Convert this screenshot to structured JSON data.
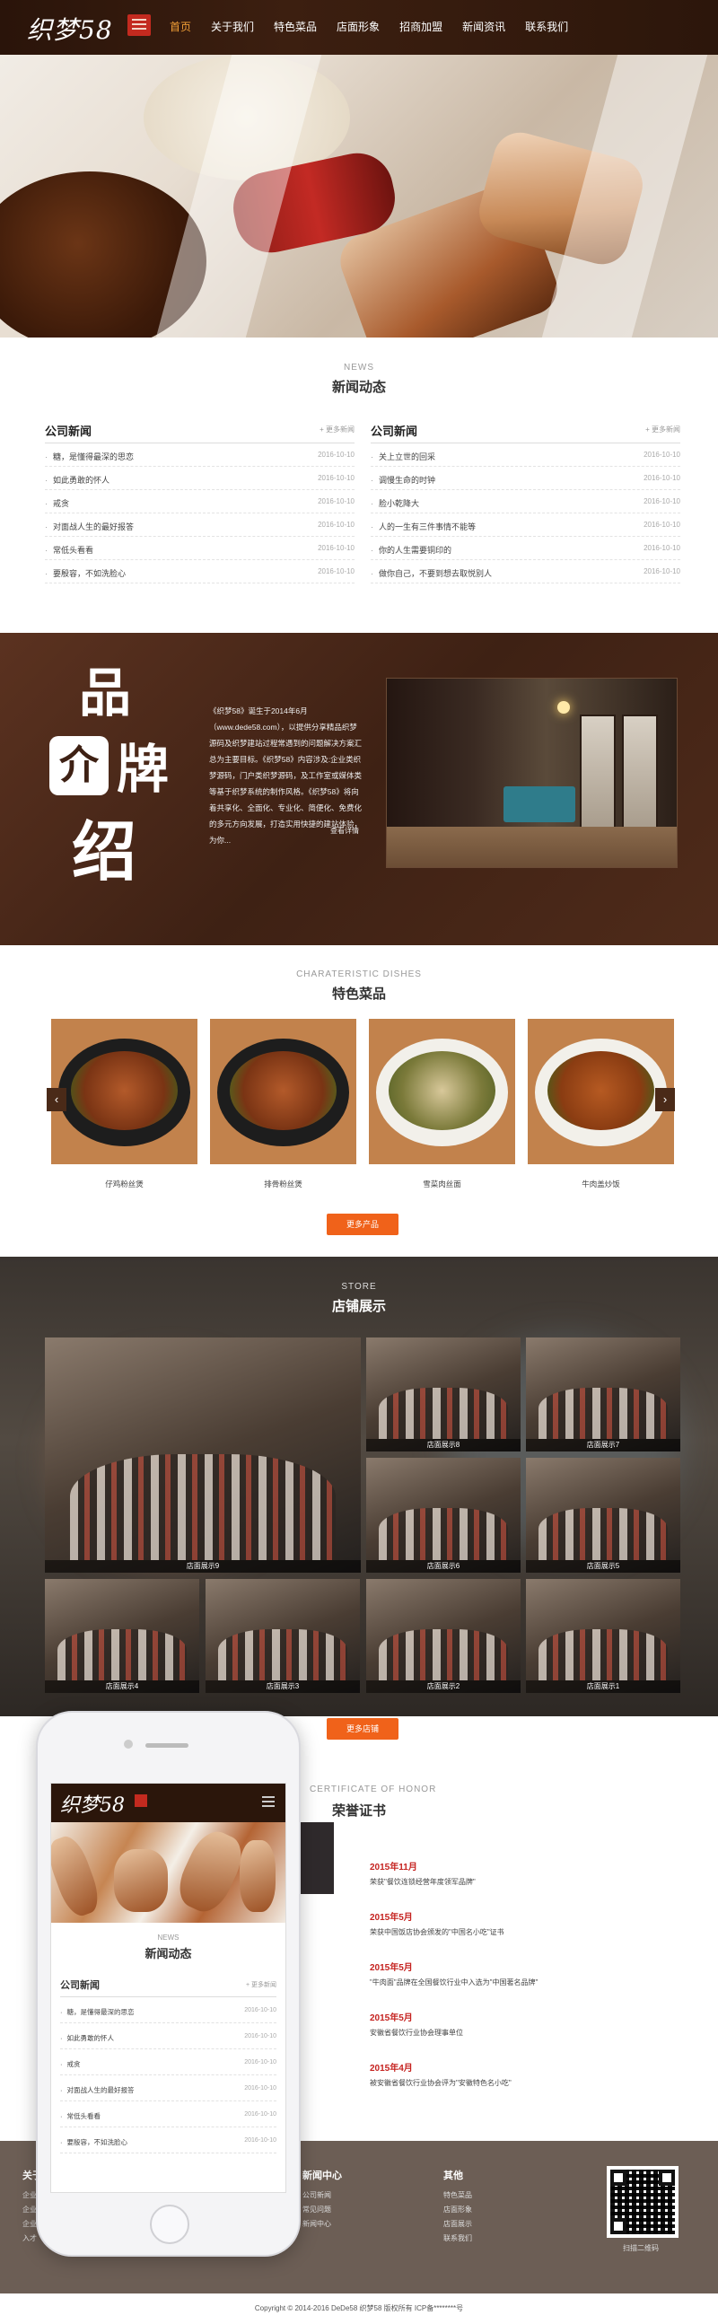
{
  "nav": {
    "logo_text": "织梦58",
    "items": [
      {
        "label": "首页",
        "active": true
      },
      {
        "label": "关于我们"
      },
      {
        "label": "特色菜品"
      },
      {
        "label": "店面形象"
      },
      {
        "label": "招商加盟"
      },
      {
        "label": "新闻资讯"
      },
      {
        "label": "联系我们"
      }
    ]
  },
  "news": {
    "en": "NEWS",
    "cn": "新闻动态",
    "columns": [
      {
        "title": "公司新闻",
        "more": "+ 更多新闻",
        "items": [
          {
            "t": "糖，是懂得最深的思恋",
            "d": "2016-10-10"
          },
          {
            "t": "如此勇敢的怀人",
            "d": "2016-10-10"
          },
          {
            "t": "戒贪",
            "d": "2016-10-10"
          },
          {
            "t": "对面战人生的最好报答",
            "d": "2016-10-10"
          },
          {
            "t": "常低头看看",
            "d": "2016-10-10"
          },
          {
            "t": "要殷容，不如洗脸心",
            "d": "2016-10-10"
          }
        ]
      },
      {
        "title": "公司新闻",
        "more": "+ 更多新闻",
        "items": [
          {
            "t": "关上立世的回采",
            "d": "2016-10-10"
          },
          {
            "t": "调慢生命的时钟",
            "d": "2016-10-10"
          },
          {
            "t": "脸小乾降大",
            "d": "2016-10-10"
          },
          {
            "t": "人的一生有三件事情不能等",
            "d": "2016-10-10"
          },
          {
            "t": "你的人生需要铜印的",
            "d": "2016-10-10"
          },
          {
            "t": "做你自己，不要到想去取悦别人",
            "d": "2016-10-10"
          }
        ]
      }
    ]
  },
  "brand": {
    "c1": "品",
    "c2": "介",
    "c3": "牌",
    "c4": "绍",
    "text": "《织梦58》诞生于2014年6月（www.dede58.com），以提供分享精品织梦源码及织梦建站过程常遇到的问题解决方案汇总为主要目标。《织梦58》内容涉及:企业类织梦源码，门户类织梦源码，及工作室或媒体类等基于织梦系统的制作风格。《织梦58》将向着共享化、全面化、专业化、简便化、免费化的多元方向发展，打造实用快捷的建站体验，为你...",
    "more": "查看详情"
  },
  "dishes": {
    "en": "CHARATERISTIC DISHES",
    "cn": "特色菜品",
    "items": [
      "仔鸡粉丝煲",
      "排骨粉丝煲",
      "雪菜肉丝面",
      "牛肉盖炒饭"
    ],
    "button": "更多产品"
  },
  "store": {
    "en": "STORE",
    "cn": "店铺展示",
    "items": [
      "店面展示9",
      "店面展示8",
      "店面展示7",
      "店面展示6",
      "店面展示5",
      "店面展示4",
      "店面展示3",
      "店面展示2",
      "店面展示1"
    ],
    "button": "更多店铺"
  },
  "cert": {
    "en": "CERTIFICATE OF HONOR",
    "cn": "荣誉证书",
    "items": [
      {
        "y": "2015年11月",
        "d": "荣获\"餐饮连锁经营年度领军品牌\""
      },
      {
        "y": "2015年5月",
        "d": "荣获中国饭店协会颁发的\"中国名小吃\"证书"
      },
      {
        "y": "2015年5月",
        "d": "\"牛肉面\"品牌在全国餐饮行业中入选为\"中国著名品牌\""
      },
      {
        "y": "2015年5月",
        "d": "安徽省餐饮行业协会理事单位"
      },
      {
        "y": "2015年4月",
        "d": "被安徽省餐饮行业协会评为\"安徽特色名小吃\""
      }
    ]
  },
  "footer": {
    "col1": "关于",
    "col2": "新闻中心",
    "col2_links": [
      "公司新闻",
      "常见问题",
      "新闻中心"
    ],
    "col3": "其他",
    "col3_links": [
      "特色菜品",
      "店面形象",
      "店面展示",
      "联系我们"
    ],
    "col1_links": [
      "企业",
      "企业",
      "企业",
      "入才"
    ],
    "qr_label": "扫描二维码",
    "copyright": "Copyright © 2014-2016 DeDe58 织梦58 版权所有    ICP备********号"
  },
  "phone": {
    "logo_text": "织梦58",
    "news_en": "NEWS",
    "news_cn": "新闻动态",
    "col_title": "公司新闻",
    "more": "+ 更多新闻",
    "items": [
      {
        "t": "糖，是懂得最深的思恋",
        "d": "2016-10-10"
      },
      {
        "t": "如此勇敢的怀人",
        "d": "2016-10-10"
      },
      {
        "t": "戒贪",
        "d": "2016-10-10"
      },
      {
        "t": "对面战人生的最好报答",
        "d": "2016-10-10"
      },
      {
        "t": "常低头看看",
        "d": "2016-10-10"
      },
      {
        "t": "要殷容，不如洗脸心",
        "d": "2016-10-10"
      }
    ]
  }
}
